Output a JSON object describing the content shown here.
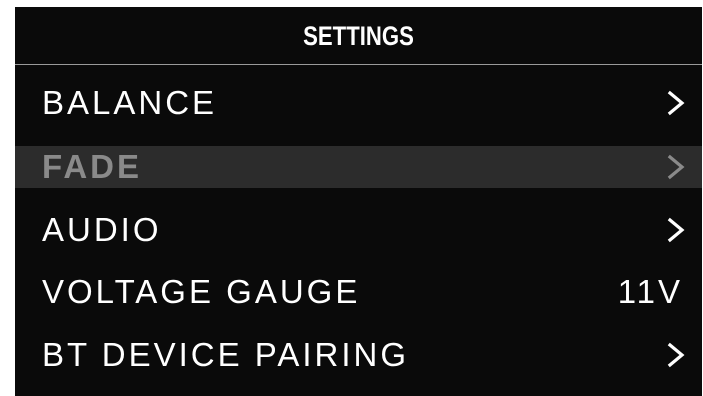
{
  "screen": {
    "title": "SETTINGS"
  },
  "menu": {
    "items": [
      {
        "label": "BALANCE",
        "trailing": "chevron-right-icon",
        "value": ""
      },
      {
        "label": "FADE",
        "trailing": "chevron-right-icon",
        "value": "",
        "selected": true
      },
      {
        "label": "AUDIO",
        "trailing": "chevron-right-icon",
        "value": ""
      },
      {
        "label": "VOLTAGE GAUGE",
        "trailing": "value",
        "value": "11V"
      },
      {
        "label": "BT DEVICE PAIRING",
        "trailing": "chevron-right-icon",
        "value": ""
      }
    ]
  },
  "colors": {
    "background": "#0a0a0a",
    "text": "#ffffff",
    "selected_text": "#8a8a8a",
    "selected_row": "#2c2c2c",
    "divider": "#9a9a9a"
  }
}
